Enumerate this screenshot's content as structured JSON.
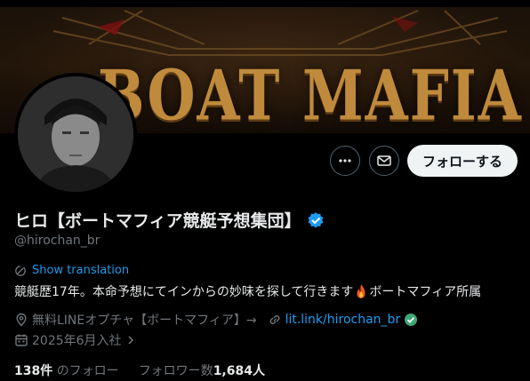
{
  "banner": {
    "title": "BOAT MAFIA"
  },
  "profile": {
    "display_name": "ヒロ【ボートマフィア競艇予想集団】",
    "handle": "@hirochan_br",
    "verified": true,
    "follow_label": "フォローする",
    "translate_label": "Show translation",
    "bio_before": "競艇歴17年。本命予想にてインからの妙味を探して行きます",
    "bio_after": "ボートマフィア所属",
    "location": "無料LINEオプチャ【ボートマフィア】→",
    "website": "lit.link/hirochan_br",
    "joined": "2025年6月入社",
    "following_count": "138件",
    "following_label": "のフォロー",
    "followers_label": "フォロワー数",
    "followers_count": "1,684人"
  },
  "colors": {
    "background": "#000000",
    "accent": "#1d9bf0",
    "muted": "#71767b",
    "text": "#e7e9ea",
    "follow_bg": "#eff3f4",
    "banner_gold": "#c08a3c"
  },
  "icons": {
    "more": "more-dots-icon",
    "message": "envelope-icon",
    "verified": "verified-badge-icon",
    "translate": "translate-icon",
    "location": "location-pin-icon",
    "link": "link-icon",
    "calendar": "calendar-icon",
    "fire": "fire-emoji",
    "check": "check-badge-emoji",
    "chevron": "chevron-right-icon"
  }
}
